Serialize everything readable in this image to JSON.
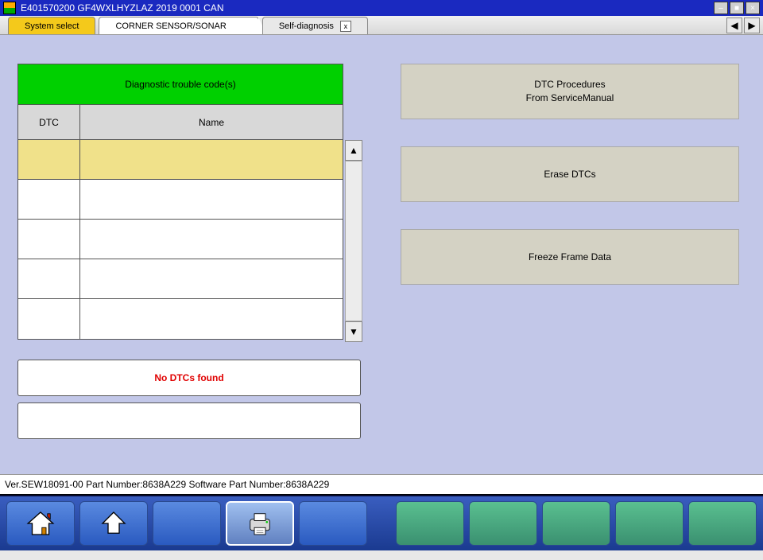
{
  "titlebar": {
    "title": "E401570200   GF4WXLHYZLAZ 2019   0001 CAN"
  },
  "tabs": {
    "system_select": "System select",
    "module": "CORNER SENSOR/SONAR",
    "self_diag": "Self-diagnosis"
  },
  "dtc": {
    "header": "Diagnostic trouble code(s)",
    "col_dtc": "DTC",
    "col_name": "Name",
    "status": "No DTCs found"
  },
  "right": {
    "btn1_line1": "DTC Procedures",
    "btn1_line2": "From ServiceManual",
    "btn2": "Erase DTCs",
    "btn3": "Freeze Frame Data"
  },
  "statusbar": {
    "text": "Ver.SEW18091-00 Part Number:8638A229   Software Part Number:8638A229"
  }
}
